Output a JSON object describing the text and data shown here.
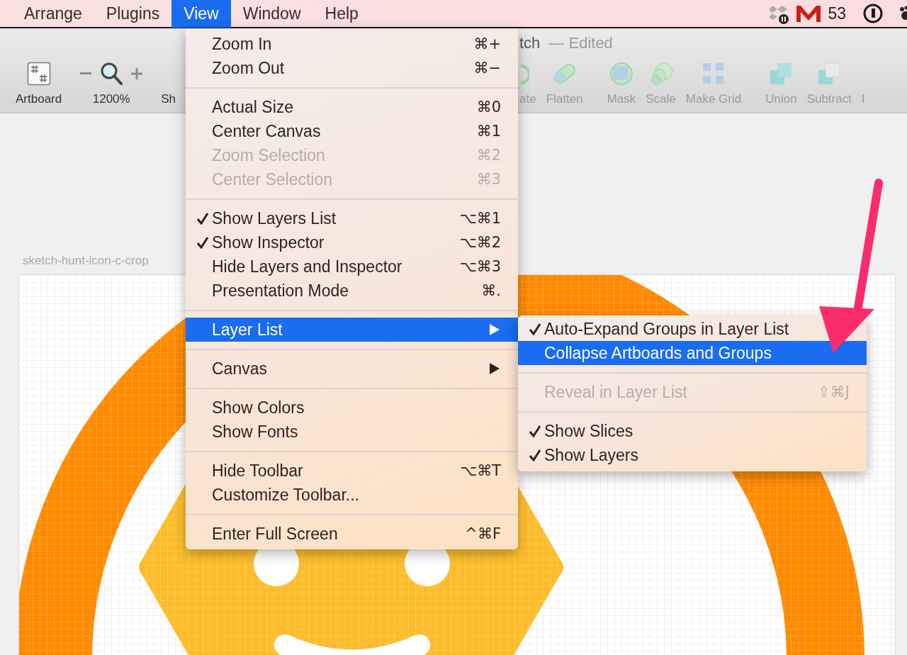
{
  "menu_bar": {
    "items": [
      {
        "label": "Arrange",
        "selected": false
      },
      {
        "label": "Plugins",
        "selected": false
      },
      {
        "label": "View",
        "selected": true
      },
      {
        "label": "Window",
        "selected": false
      },
      {
        "label": "Help",
        "selected": false
      }
    ],
    "mail_count": "53"
  },
  "window": {
    "title": "tch",
    "status": "— Edited"
  },
  "toolbar": {
    "left": [
      {
        "label": "Artboard",
        "disabled": false
      },
      {
        "label": "1200%",
        "disabled": false
      },
      {
        "label": "Sh",
        "disabled": false
      }
    ],
    "groups": [
      [
        {
          "label": "ate",
          "disabled": true
        },
        {
          "label": "Flatten",
          "disabled": true
        }
      ],
      [
        {
          "label": "Mask",
          "disabled": true
        },
        {
          "label": "Scale",
          "disabled": true
        },
        {
          "label": "Make Grid",
          "disabled": true
        }
      ],
      [
        {
          "label": "Union",
          "disabled": true
        },
        {
          "label": "Subtract",
          "disabled": true
        },
        {
          "label": "I",
          "disabled": true
        }
      ]
    ]
  },
  "canvas": {
    "artboard_label": "sketch-hunt-icon-c-crop"
  },
  "view_menu": {
    "sections": [
      {
        "items": [
          {
            "label": "Zoom In",
            "shortcut": "⌘+",
            "checked": false,
            "disabled": false,
            "selected": false,
            "has_submenu": false
          },
          {
            "label": "Zoom Out",
            "shortcut": "⌘−",
            "checked": false,
            "disabled": false,
            "selected": false,
            "has_submenu": false
          }
        ]
      },
      {
        "items": [
          {
            "label": "Actual Size",
            "shortcut": "⌘0",
            "checked": false,
            "disabled": false,
            "selected": false,
            "has_submenu": false
          },
          {
            "label": "Center Canvas",
            "shortcut": "⌘1",
            "checked": false,
            "disabled": false,
            "selected": false,
            "has_submenu": false
          },
          {
            "label": "Zoom Selection",
            "shortcut": "⌘2",
            "checked": false,
            "disabled": true,
            "selected": false,
            "has_submenu": false
          },
          {
            "label": "Center Selection",
            "shortcut": "⌘3",
            "checked": false,
            "disabled": true,
            "selected": false,
            "has_submenu": false
          }
        ]
      },
      {
        "items": [
          {
            "label": "Show Layers List",
            "shortcut": "⌥⌘1",
            "checked": true,
            "disabled": false,
            "selected": false,
            "has_submenu": false
          },
          {
            "label": "Show Inspector",
            "shortcut": "⌥⌘2",
            "checked": true,
            "disabled": false,
            "selected": false,
            "has_submenu": false
          },
          {
            "label": "Hide Layers and Inspector",
            "shortcut": "⌥⌘3",
            "checked": false,
            "disabled": false,
            "selected": false,
            "has_submenu": false
          },
          {
            "label": "Presentation Mode",
            "shortcut": "⌘.",
            "checked": false,
            "disabled": false,
            "selected": false,
            "has_submenu": false
          }
        ]
      },
      {
        "items": [
          {
            "label": "Layer List",
            "checked": false,
            "disabled": false,
            "selected": true,
            "has_submenu": true
          }
        ]
      },
      {
        "items": [
          {
            "label": "Canvas",
            "checked": false,
            "disabled": false,
            "selected": false,
            "has_submenu": true
          }
        ]
      },
      {
        "items": [
          {
            "label": "Show Colors",
            "checked": false,
            "disabled": false,
            "selected": false,
            "has_submenu": false
          },
          {
            "label": "Show Fonts",
            "checked": false,
            "disabled": false,
            "selected": false,
            "has_submenu": false
          }
        ]
      },
      {
        "items": [
          {
            "label": "Hide Toolbar",
            "shortcut": "⌥⌘T",
            "checked": false,
            "disabled": false,
            "selected": false,
            "has_submenu": false
          },
          {
            "label": "Customize Toolbar...",
            "checked": false,
            "disabled": false,
            "selected": false,
            "has_submenu": false
          }
        ]
      },
      {
        "items": [
          {
            "label": "Enter Full Screen",
            "shortcut": "^⌘F",
            "checked": false,
            "disabled": false,
            "selected": false,
            "has_submenu": false
          }
        ]
      }
    ]
  },
  "layer_list_submenu": {
    "sections": [
      {
        "items": [
          {
            "label": "Auto-Expand Groups in Layer List",
            "checked": true,
            "disabled": false,
            "selected": false,
            "has_submenu": false
          },
          {
            "label": "Collapse Artboards and Groups",
            "checked": false,
            "disabled": false,
            "selected": true,
            "has_submenu": false
          }
        ]
      },
      {
        "items": [
          {
            "label": "Reveal in Layer List",
            "shortcut": "⇧⌘J",
            "checked": false,
            "disabled": true,
            "selected": false,
            "has_submenu": false
          }
        ]
      },
      {
        "items": [
          {
            "label": "Show Slices",
            "checked": true,
            "disabled": false,
            "selected": false,
            "has_submenu": false
          },
          {
            "label": "Show Layers",
            "checked": true,
            "disabled": false,
            "selected": false,
            "has_submenu": false
          }
        ]
      }
    ]
  }
}
